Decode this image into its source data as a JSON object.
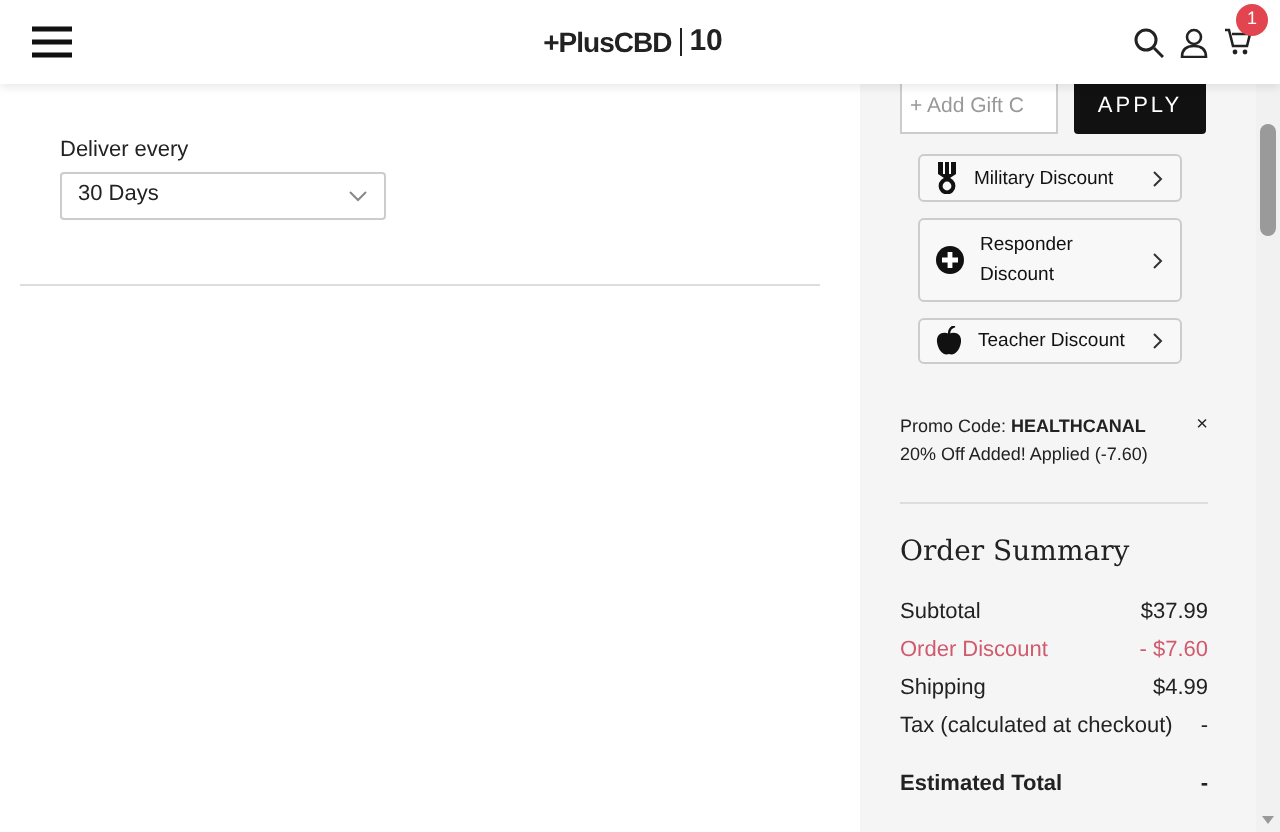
{
  "header": {
    "logo": "+PlusCBD",
    "logo_badge": "10",
    "cart_count": "1"
  },
  "subscription": {
    "label": "Deliver every",
    "value": "30 Days"
  },
  "gift_card": {
    "placeholder": "+ Add Gift C",
    "button": "APPLY"
  },
  "discounts": [
    {
      "kind": "military",
      "label": "Military Discount"
    },
    {
      "kind": "responder",
      "label": "Responder Discount"
    },
    {
      "kind": "teacher",
      "label": "Teacher Discount"
    }
  ],
  "promo": {
    "text": "Promo Code: **HEALTHCANAL**",
    "detail": "20% Off Added! Applied (-7.60)",
    "remove": "×"
  },
  "summary": {
    "title": "Order Summary",
    "rows": [
      {
        "kind": "normal",
        "label": "Subtotal",
        "value": "$37.99"
      },
      {
        "kind": "discount",
        "label": "Order Discount",
        "value": "- $7.60"
      },
      {
        "kind": "normal",
        "label": "Shipping",
        "value": "$4.99"
      },
      {
        "kind": "normal",
        "label": "Tax (calculated at checkout)",
        "value": "-"
      }
    ],
    "total": {
      "label": "Estimated Total",
      "value": "-"
    }
  }
}
